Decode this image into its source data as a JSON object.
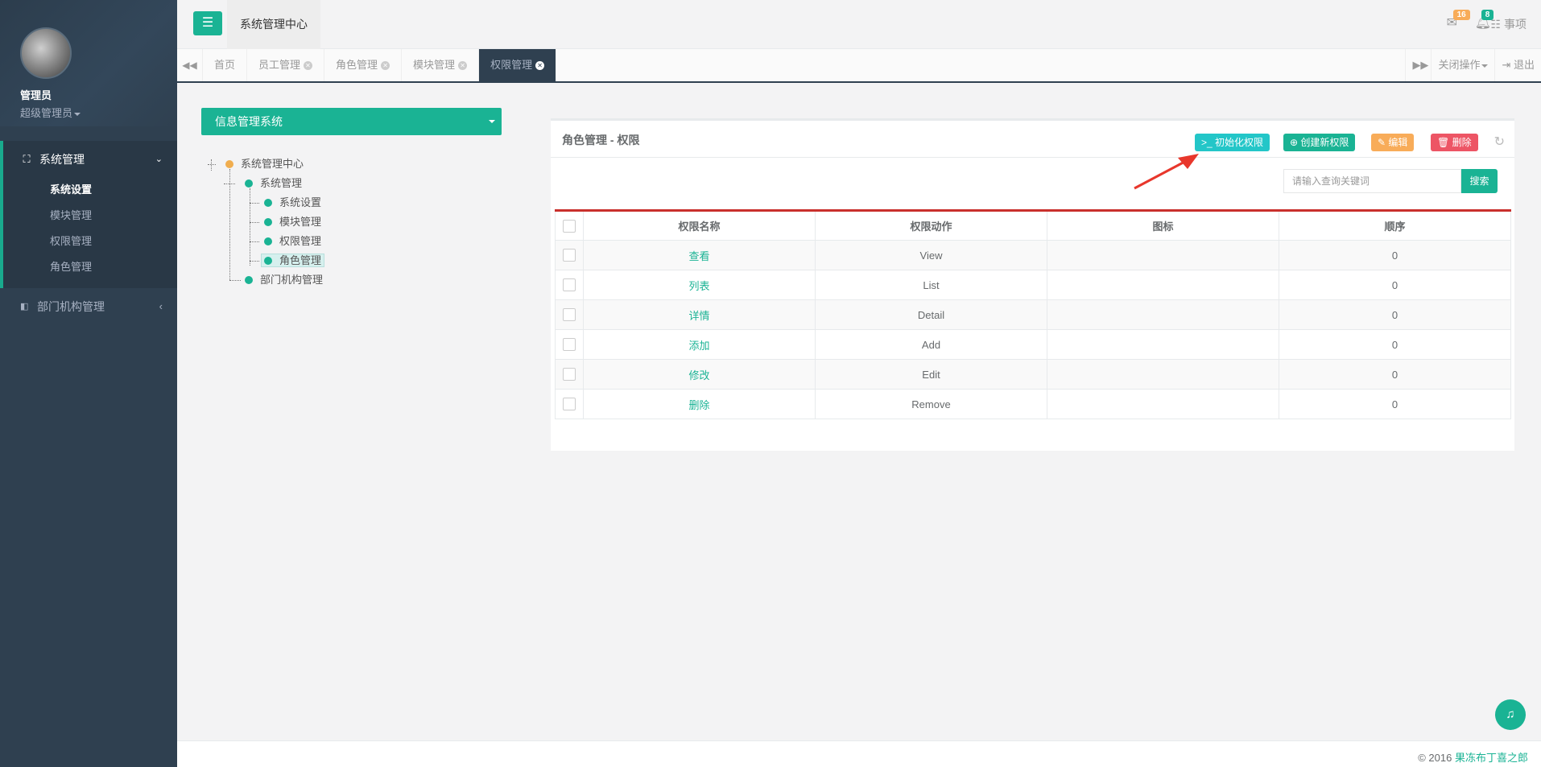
{
  "sidebar": {
    "user_name": "管理员",
    "user_role": "超级管理员",
    "groups": [
      {
        "label": "系统管理",
        "icon": "sitemap-icon",
        "expanded": true,
        "items": [
          {
            "label": "系统设置",
            "active": true
          },
          {
            "label": "模块管理",
            "active": false
          },
          {
            "label": "权限管理",
            "active": false
          },
          {
            "label": "角色管理",
            "active": false
          }
        ]
      },
      {
        "label": "部门机构管理",
        "icon": "caret-square-icon",
        "expanded": false
      }
    ]
  },
  "header": {
    "system_title": "系统管理中心",
    "mail_count": "16",
    "bell_count": "8",
    "todo_label": "事项"
  },
  "tabs": {
    "items": [
      {
        "label": "首页",
        "closable": false,
        "active": false
      },
      {
        "label": "员工管理",
        "closable": true,
        "active": false
      },
      {
        "label": "角色管理",
        "closable": true,
        "active": false
      },
      {
        "label": "模块管理",
        "closable": true,
        "active": false
      },
      {
        "label": "权限管理",
        "closable": true,
        "active": true
      }
    ],
    "close_ops_label": "关闭操作",
    "logout_label": "退出"
  },
  "tree_panel": {
    "select_label": "信息管理系统",
    "nodes": [
      {
        "label": "系统管理中心",
        "level": 0,
        "color": "orange"
      },
      {
        "label": "系统管理",
        "level": 1,
        "color": "green"
      },
      {
        "label": "系统设置",
        "level": 2,
        "color": "green"
      },
      {
        "label": "模块管理",
        "level": 2,
        "color": "green"
      },
      {
        "label": "权限管理",
        "level": 2,
        "color": "green"
      },
      {
        "label": "角色管理",
        "level": 2,
        "color": "green",
        "selected": true
      },
      {
        "label": "部门机构管理",
        "level": 1,
        "color": "green"
      }
    ]
  },
  "main_panel": {
    "title": "角色管理 - 权限",
    "buttons": {
      "init": "初始化权限",
      "create": "创建新权限",
      "edit": "编辑",
      "delete": "删除"
    },
    "search_placeholder": "请输入查询关键词",
    "search_button": "搜索",
    "table": {
      "headers": [
        "权限名称",
        "权限动作",
        "图标",
        "顺序"
      ],
      "rows": [
        {
          "name": "查看",
          "action": "View",
          "icon": "",
          "order": "0"
        },
        {
          "name": "列表",
          "action": "List",
          "icon": "",
          "order": "0"
        },
        {
          "name": "详情",
          "action": "Detail",
          "icon": "",
          "order": "0"
        },
        {
          "name": "添加",
          "action": "Add",
          "icon": "",
          "order": "0"
        },
        {
          "name": "修改",
          "action": "Edit",
          "icon": "",
          "order": "0"
        },
        {
          "name": "删除",
          "action": "Remove",
          "icon": "",
          "order": "0"
        }
      ]
    }
  },
  "footer": {
    "copyright": "© 2016",
    "brand": "果冻布丁喜之郎"
  },
  "colors": {
    "sidebar_bg": "#2f4050",
    "accent": "#1ab394",
    "info": "#23c6c8",
    "warning": "#f8ac59",
    "danger": "#ed5565",
    "table_top_border": "#c9302c",
    "annotation_arrow": "#e8372c"
  }
}
